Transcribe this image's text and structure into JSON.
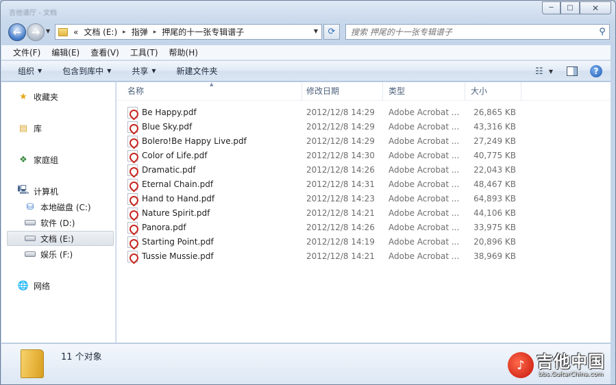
{
  "window": {
    "title": "吉他谱厅 - 文档",
    "buttons": {
      "minimize": "─",
      "maximize": "□",
      "close": "✕"
    }
  },
  "address": {
    "prefix": "«",
    "segments": [
      "文档 (E:)",
      "指弹",
      "押尾的十一张专辑谱子"
    ],
    "separator": "▸"
  },
  "search": {
    "placeholder": "搜索 押尾的十一张专辑谱子"
  },
  "menu": [
    "文件(F)",
    "编辑(E)",
    "查看(V)",
    "工具(T)",
    "帮助(H)"
  ],
  "commands": {
    "organize": "组织",
    "include": "包含到库中",
    "share": "共享",
    "new_folder": "新建文件夹"
  },
  "nav": {
    "favorites": "收藏夹",
    "libraries": "库",
    "homegroup": "家庭组",
    "computer": "计算机",
    "drive_c": "本地磁盘 (C:)",
    "drive_d": "软件 (D:)",
    "drive_e": "文档 (E:)",
    "drive_f": "娱乐 (F:)",
    "network": "网络"
  },
  "columns": {
    "name": "名称",
    "date": "修改日期",
    "type": "类型",
    "size": "大小"
  },
  "files": [
    {
      "name": "Be Happy.pdf",
      "date": "2012/12/8 14:29",
      "type": "Adobe Acrobat ...",
      "size": "26,865 KB"
    },
    {
      "name": "Blue Sky.pdf",
      "date": "2012/12/8 14:29",
      "type": "Adobe Acrobat ...",
      "size": "43,316 KB"
    },
    {
      "name": "Bolero!Be Happy Live.pdf",
      "date": "2012/12/8 14:29",
      "type": "Adobe Acrobat ...",
      "size": "27,249 KB"
    },
    {
      "name": "Color of Life.pdf",
      "date": "2012/12/8 14:30",
      "type": "Adobe Acrobat ...",
      "size": "40,775 KB"
    },
    {
      "name": "Dramatic.pdf",
      "date": "2012/12/8 14:26",
      "type": "Adobe Acrobat ...",
      "size": "22,043 KB"
    },
    {
      "name": "Eternal Chain.pdf",
      "date": "2012/12/8 14:31",
      "type": "Adobe Acrobat ...",
      "size": "48,467 KB"
    },
    {
      "name": "Hand to Hand.pdf",
      "date": "2012/12/8 14:23",
      "type": "Adobe Acrobat ...",
      "size": "64,893 KB"
    },
    {
      "name": "Nature Spirit.pdf",
      "date": "2012/12/8 14:21",
      "type": "Adobe Acrobat ...",
      "size": "44,106 KB"
    },
    {
      "name": "Panora.pdf",
      "date": "2012/12/8 14:26",
      "type": "Adobe Acrobat ...",
      "size": "33,975 KB"
    },
    {
      "name": "Starting Point.pdf",
      "date": "2012/12/8 14:19",
      "type": "Adobe Acrobat ...",
      "size": "20,896 KB"
    },
    {
      "name": "Tussie Mussie.pdf",
      "date": "2012/12/8 14:21",
      "type": "Adobe Acrobat ...",
      "size": "38,969 KB"
    }
  ],
  "status": {
    "count_text": "11 个对象"
  },
  "watermark": {
    "name": "吉他中国",
    "url": "bbs.GuitarChina.com"
  },
  "colors": {
    "accent": "#3f78c6",
    "pdf_red": "#c8251d",
    "selection": "#dde3ea"
  },
  "icons": [
    "back-arrow-icon",
    "forward-arrow-icon",
    "folder-icon",
    "refresh-icon",
    "search-icon",
    "views-icon",
    "preview-pane-icon",
    "help-icon",
    "star-icon",
    "library-icon",
    "homegroup-icon",
    "computer-icon",
    "drive-icon",
    "network-icon",
    "pdf-icon"
  ]
}
